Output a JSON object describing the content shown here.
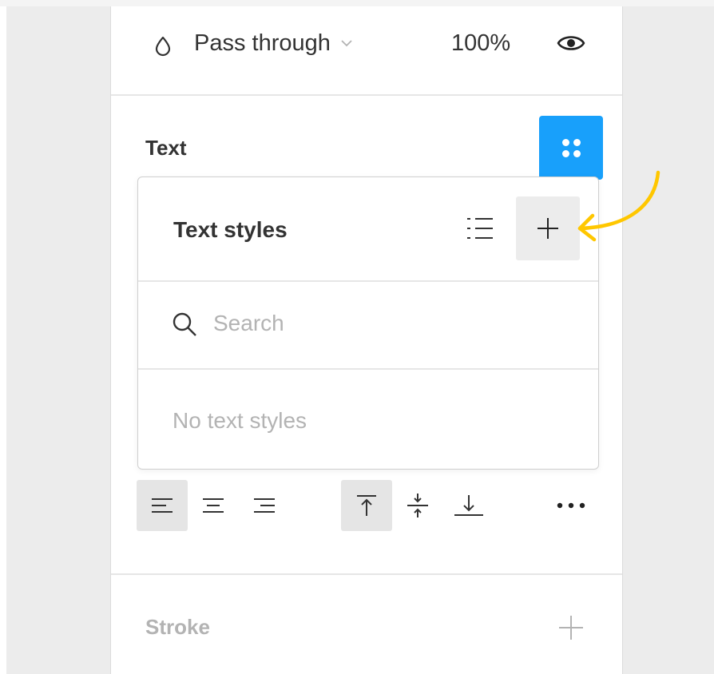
{
  "layer": {
    "blend_mode": "Pass through",
    "opacity": "100%"
  },
  "text_section": {
    "title": "Text"
  },
  "text_styles_popup": {
    "title": "Text styles",
    "search_placeholder": "Search",
    "empty_message": "No text styles"
  },
  "stroke_section": {
    "title": "Stroke"
  },
  "icons": {
    "blend": "drop-icon",
    "blend_dropdown": "chevron-down-icon",
    "visibility": "eye-icon",
    "styles": "four-dots-icon",
    "list_view": "list-icon",
    "create_style": "plus-icon",
    "search": "search-icon",
    "align_left": "align-left-icon",
    "align_center": "align-center-icon",
    "align_right": "align-right-icon",
    "align_top": "align-top-icon",
    "align_middle": "align-middle-icon",
    "align_bottom": "align-bottom-icon",
    "more": "more-icon",
    "add_stroke": "plus-icon",
    "annotation": "arrow-annotation-icon"
  },
  "colors": {
    "accent": "#18a0fb",
    "annotation": "#ffc700",
    "muted_text": "#b3b3b3",
    "active_bg": "#e5e5e5"
  }
}
